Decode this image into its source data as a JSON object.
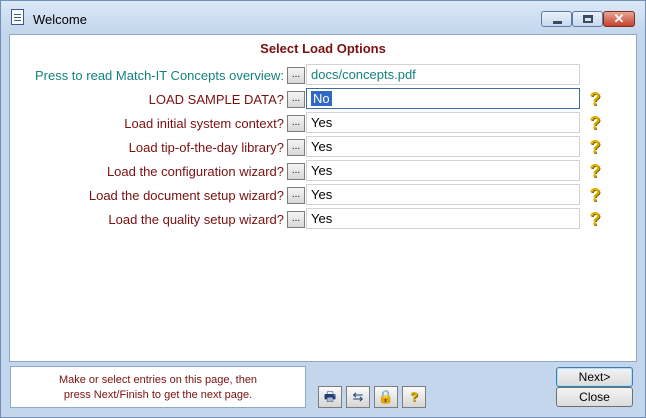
{
  "window": {
    "title": "Welcome",
    "icon": "document-icon"
  },
  "heading": "Select Load Options",
  "rows": [
    {
      "label": "Press to read Match-IT Concepts overview:",
      "dots": "...",
      "value": "docs/concepts.pdf",
      "help": ""
    },
    {
      "label": "LOAD SAMPLE DATA?",
      "dots": "...",
      "value": "No",
      "help": "?"
    },
    {
      "label": "Load initial system context?",
      "dots": "...",
      "value": "Yes",
      "help": "?"
    },
    {
      "label": "Load tip-of-the-day library?",
      "dots": "...",
      "value": "Yes",
      "help": "?"
    },
    {
      "label": "Load the configuration wizard?",
      "dots": "...",
      "value": "Yes",
      "help": "?"
    },
    {
      "label": "Load the document setup wizard?",
      "dots": "...",
      "value": "Yes",
      "help": "?"
    },
    {
      "label": "Load the quality setup wizard?",
      "dots": "...",
      "value": "Yes",
      "help": "?"
    }
  ],
  "status": {
    "line1": "Make or select entries on this page, then",
    "line2": "press Next/Finish to get the next page."
  },
  "toolbar": {
    "print_icon": "🖶",
    "columns_icon": "⇆",
    "lock_icon": "🔒",
    "help_icon": "?"
  },
  "buttons": {
    "next": "Next>",
    "close": "Close"
  },
  "colors": {
    "label": "#7a1010",
    "teal": "#14827e",
    "selection": "#3168c5",
    "help": "#e0b000"
  }
}
